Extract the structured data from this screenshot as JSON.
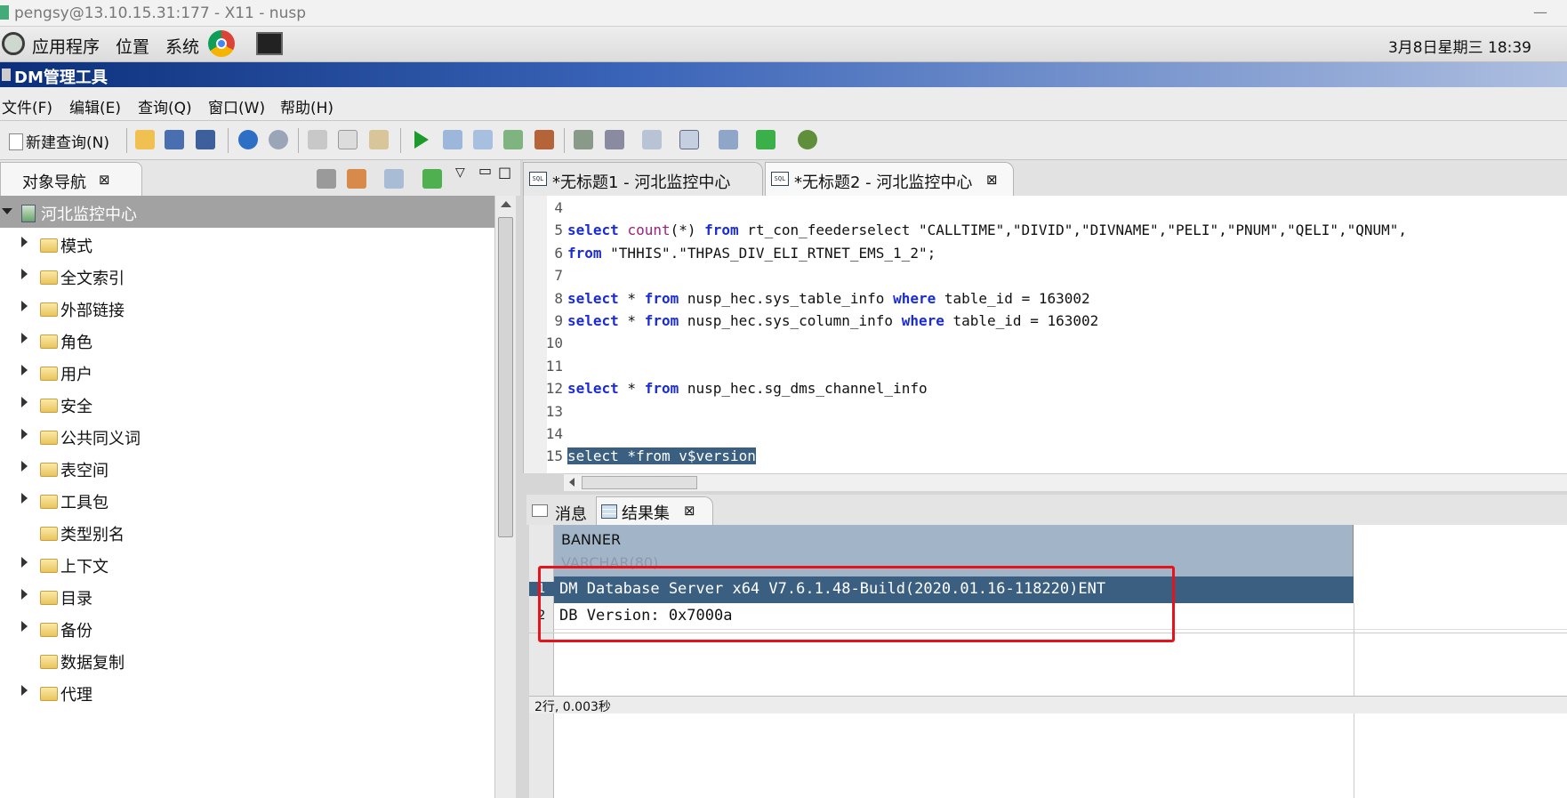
{
  "window": {
    "x11_title": "pengsy@13.10.15.31:177 - X11 - nusp",
    "app_title": "DM管理工具"
  },
  "panel": {
    "menus": [
      "应用程序",
      "位置",
      "系统"
    ],
    "clock": "3月8日星期三 18:39"
  },
  "menubar": {
    "items": [
      "文件(F)",
      "编辑(E)",
      "查询(Q)",
      "窗口(W)",
      "帮助(H)"
    ]
  },
  "toolbar": {
    "new_query_label": "新建查询(N)"
  },
  "navigator": {
    "tab_label": "对象导航",
    "root": "河北监控中心",
    "items": [
      {
        "label": "模式",
        "expandable": true
      },
      {
        "label": "全文索引",
        "expandable": true
      },
      {
        "label": "外部链接",
        "expandable": true
      },
      {
        "label": "角色",
        "expandable": true
      },
      {
        "label": "用户",
        "expandable": true
      },
      {
        "label": "安全",
        "expandable": true
      },
      {
        "label": "公共同义词",
        "expandable": true
      },
      {
        "label": "表空间",
        "expandable": true
      },
      {
        "label": "工具包",
        "expandable": true
      },
      {
        "label": "类型别名",
        "expandable": false
      },
      {
        "label": "上下文",
        "expandable": true
      },
      {
        "label": "目录",
        "expandable": true
      },
      {
        "label": "备份",
        "expandable": true
      },
      {
        "label": "数据复制",
        "expandable": false
      },
      {
        "label": "代理",
        "expandable": true
      }
    ]
  },
  "editor_tabs": [
    {
      "label": "*无标题1 - 河北监控中心",
      "active": false
    },
    {
      "label": "*无标题2 - 河北监控中心",
      "active": true
    }
  ],
  "editor": {
    "lines": [
      {
        "n": "4",
        "text": ""
      },
      {
        "n": "5",
        "text": "select count(*) from rt_con_feederselect \"CALLTIME\",\"DIVID\",\"DIVNAME\",\"PELI\",\"PNUM\",\"QELI\",\"QNUM\","
      },
      {
        "n": "6",
        "text": "from \"THHIS\".\"THPAS_DIV_ELI_RTNET_EMS_1_2\";"
      },
      {
        "n": "7",
        "text": ""
      },
      {
        "n": "8",
        "text": "select * from nusp_hec.sys_table_info where table_id = 163002"
      },
      {
        "n": "9",
        "text": "select * from nusp_hec.sys_column_info where table_id = 163002"
      },
      {
        "n": "10",
        "text": ""
      },
      {
        "n": "11",
        "text": ""
      },
      {
        "n": "12",
        "text": "select * from nusp_hec.sg_dms_channel_info"
      },
      {
        "n": "13",
        "text": ""
      },
      {
        "n": "14",
        "text": ""
      },
      {
        "n": "15",
        "text": "select *from v$version"
      }
    ]
  },
  "results": {
    "tabs": [
      "消息",
      "结果集"
    ],
    "column_name": "BANNER",
    "column_type": "VARCHAR(80)",
    "rows": [
      {
        "n": "1",
        "value": "DM Database Server x64 V7.6.1.48-Build(2020.01.16-118220)ENT"
      },
      {
        "n": "2",
        "value": "DB Version: 0x7000a"
      }
    ],
    "status": "2行, 0.003秒"
  },
  "colors": {
    "accent_red": "#e8121b",
    "selection": "#3a5f80",
    "keyword": "#1a2bd8"
  }
}
